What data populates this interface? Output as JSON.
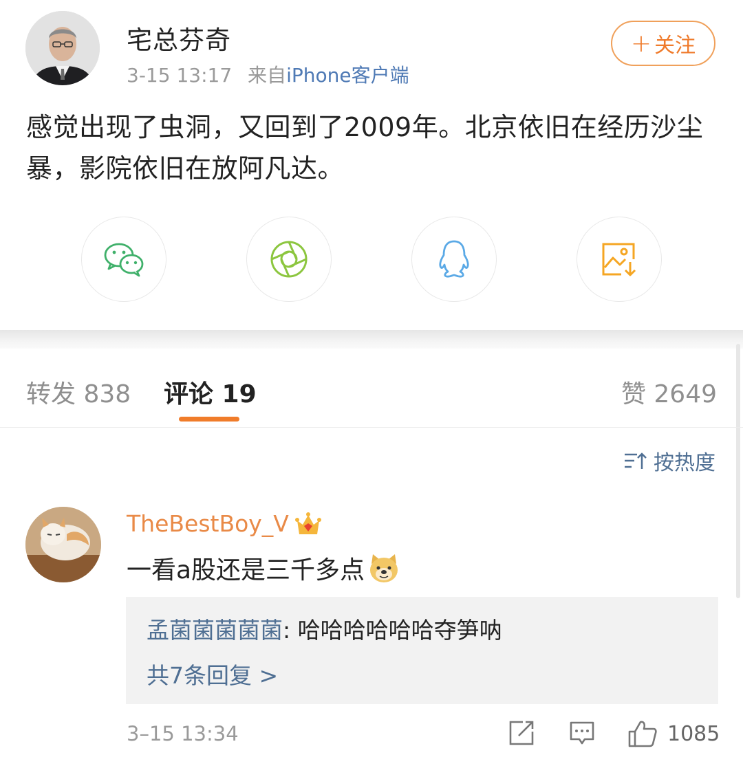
{
  "post": {
    "username": "宅总芬奇",
    "time": "3-15 13:17",
    "source_prefix": "来自",
    "source": "iPhone客户端",
    "follow_label": "关注",
    "follow_plus": "+",
    "text": "感觉出现了虫洞，又回到了2009年。北京依旧在经历沙尘暴，影院依旧在放阿凡达。"
  },
  "share_icons": [
    "wechat-icon",
    "moments-icon",
    "qq-icon",
    "save-image-icon"
  ],
  "tabs": {
    "repost": "转发 838",
    "comments": "评论 19",
    "likes": "赞 2649"
  },
  "sort_label": "按热度",
  "comment": {
    "username": "TheBestBoy_V",
    "text": "一看a股还是三千多点",
    "reply_user": "孟菌菌菌菌菌",
    "reply_sep": ": ",
    "reply_text": "哈哈哈哈哈哈夺笋呐",
    "more_replies": "共7条回复 >",
    "time": "3–15 13:34",
    "like_count": "1085"
  },
  "colors": {
    "accent_orange": "#f07c2a",
    "link_blue": "#4f6f93",
    "username_orange": "#e98a47"
  }
}
